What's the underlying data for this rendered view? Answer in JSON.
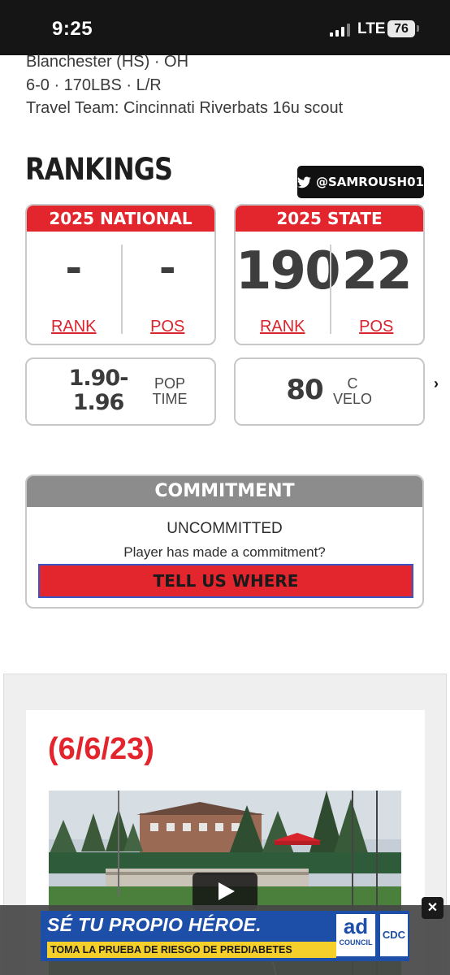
{
  "status_bar": {
    "time": "9:25",
    "network": "LTE",
    "battery": "76"
  },
  "player": {
    "school": "Blanchester (HS) · OH",
    "measurements": "6-0 · 170LBS · L/R",
    "travel_team": "Travel Team: Cincinnati Riverbats 16u scout"
  },
  "rankings": {
    "title": "RANKINGS",
    "twitter_handle": "@SAMROUSH01",
    "national": {
      "header": "2025 NATIONAL",
      "rank": "-",
      "rank_label": "RANK",
      "pos": "-",
      "pos_label": "POS"
    },
    "state": {
      "header": "2025 STATE",
      "rank": "190",
      "rank_label": "RANK",
      "pos": "22",
      "pos_label": "POS"
    }
  },
  "metrics": {
    "pop_time": {
      "value_line1": "1.90-",
      "value_line2": "1.96",
      "label_line1": "POP",
      "label_line2": "TIME"
    },
    "c_velo": {
      "value": "80",
      "label_line1": "C",
      "label_line2": "VELO"
    },
    "next_icon": "chevron-right-icon"
  },
  "commitment": {
    "header": "COMMITMENT",
    "status": "UNCOMMITTED",
    "question": "Player has made a commitment?",
    "button_label": "TELL US WHERE"
  },
  "video_section": {
    "date_title": "(6/6/23)"
  },
  "ad": {
    "headline": "SÉ TU PROPIO HÉROE.",
    "subline": "TOMA LA PRUEBA DE RIESGO DE PREDIABETES",
    "council_line1": "ad",
    "council_line2": "COUNCIL",
    "cdc_label": "CDC",
    "close": "✕"
  },
  "colors": {
    "accent_red": "#e3262e",
    "gray_header": "#8c8c8c",
    "ad_blue": "#1d4fa8",
    "ad_yellow": "#f5d02b"
  }
}
